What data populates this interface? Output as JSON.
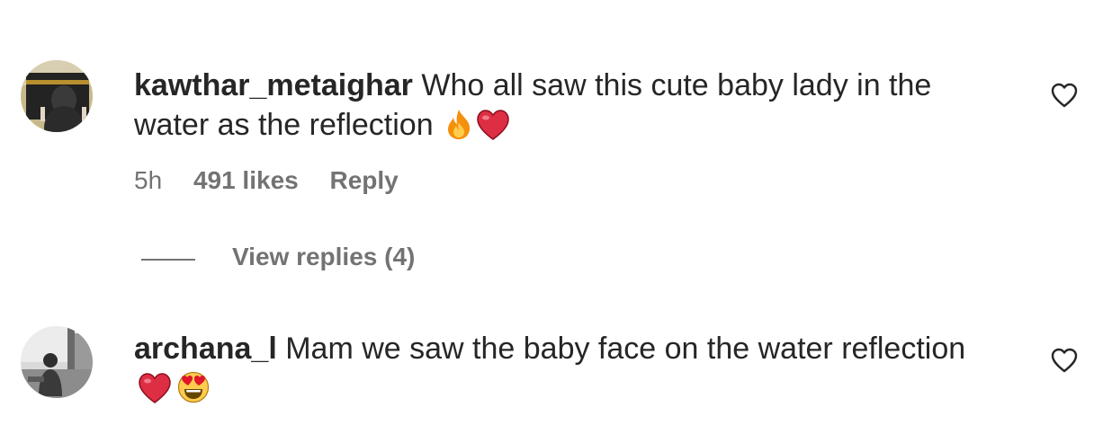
{
  "comments": [
    {
      "username": "kawthar_metaighar",
      "text": "Who all saw this cute baby lady in the water as the reflection",
      "emojis": [
        "fire-emoji",
        "red-heart-emoji"
      ],
      "time": "5h",
      "likes": "491 likes",
      "reply_label": "Reply",
      "view_replies": "View replies (4)",
      "like_icon": "heart-outline-icon"
    },
    {
      "username": "archana_l",
      "text": "Mam we saw the baby face on the water reflection",
      "emojis": [
        "red-heart-emoji",
        "heart-eyes-emoji"
      ],
      "like_icon": "heart-outline-icon"
    }
  ],
  "colors": {
    "text": "#262626",
    "secondary": "#737373",
    "heart": "#e0162b"
  }
}
